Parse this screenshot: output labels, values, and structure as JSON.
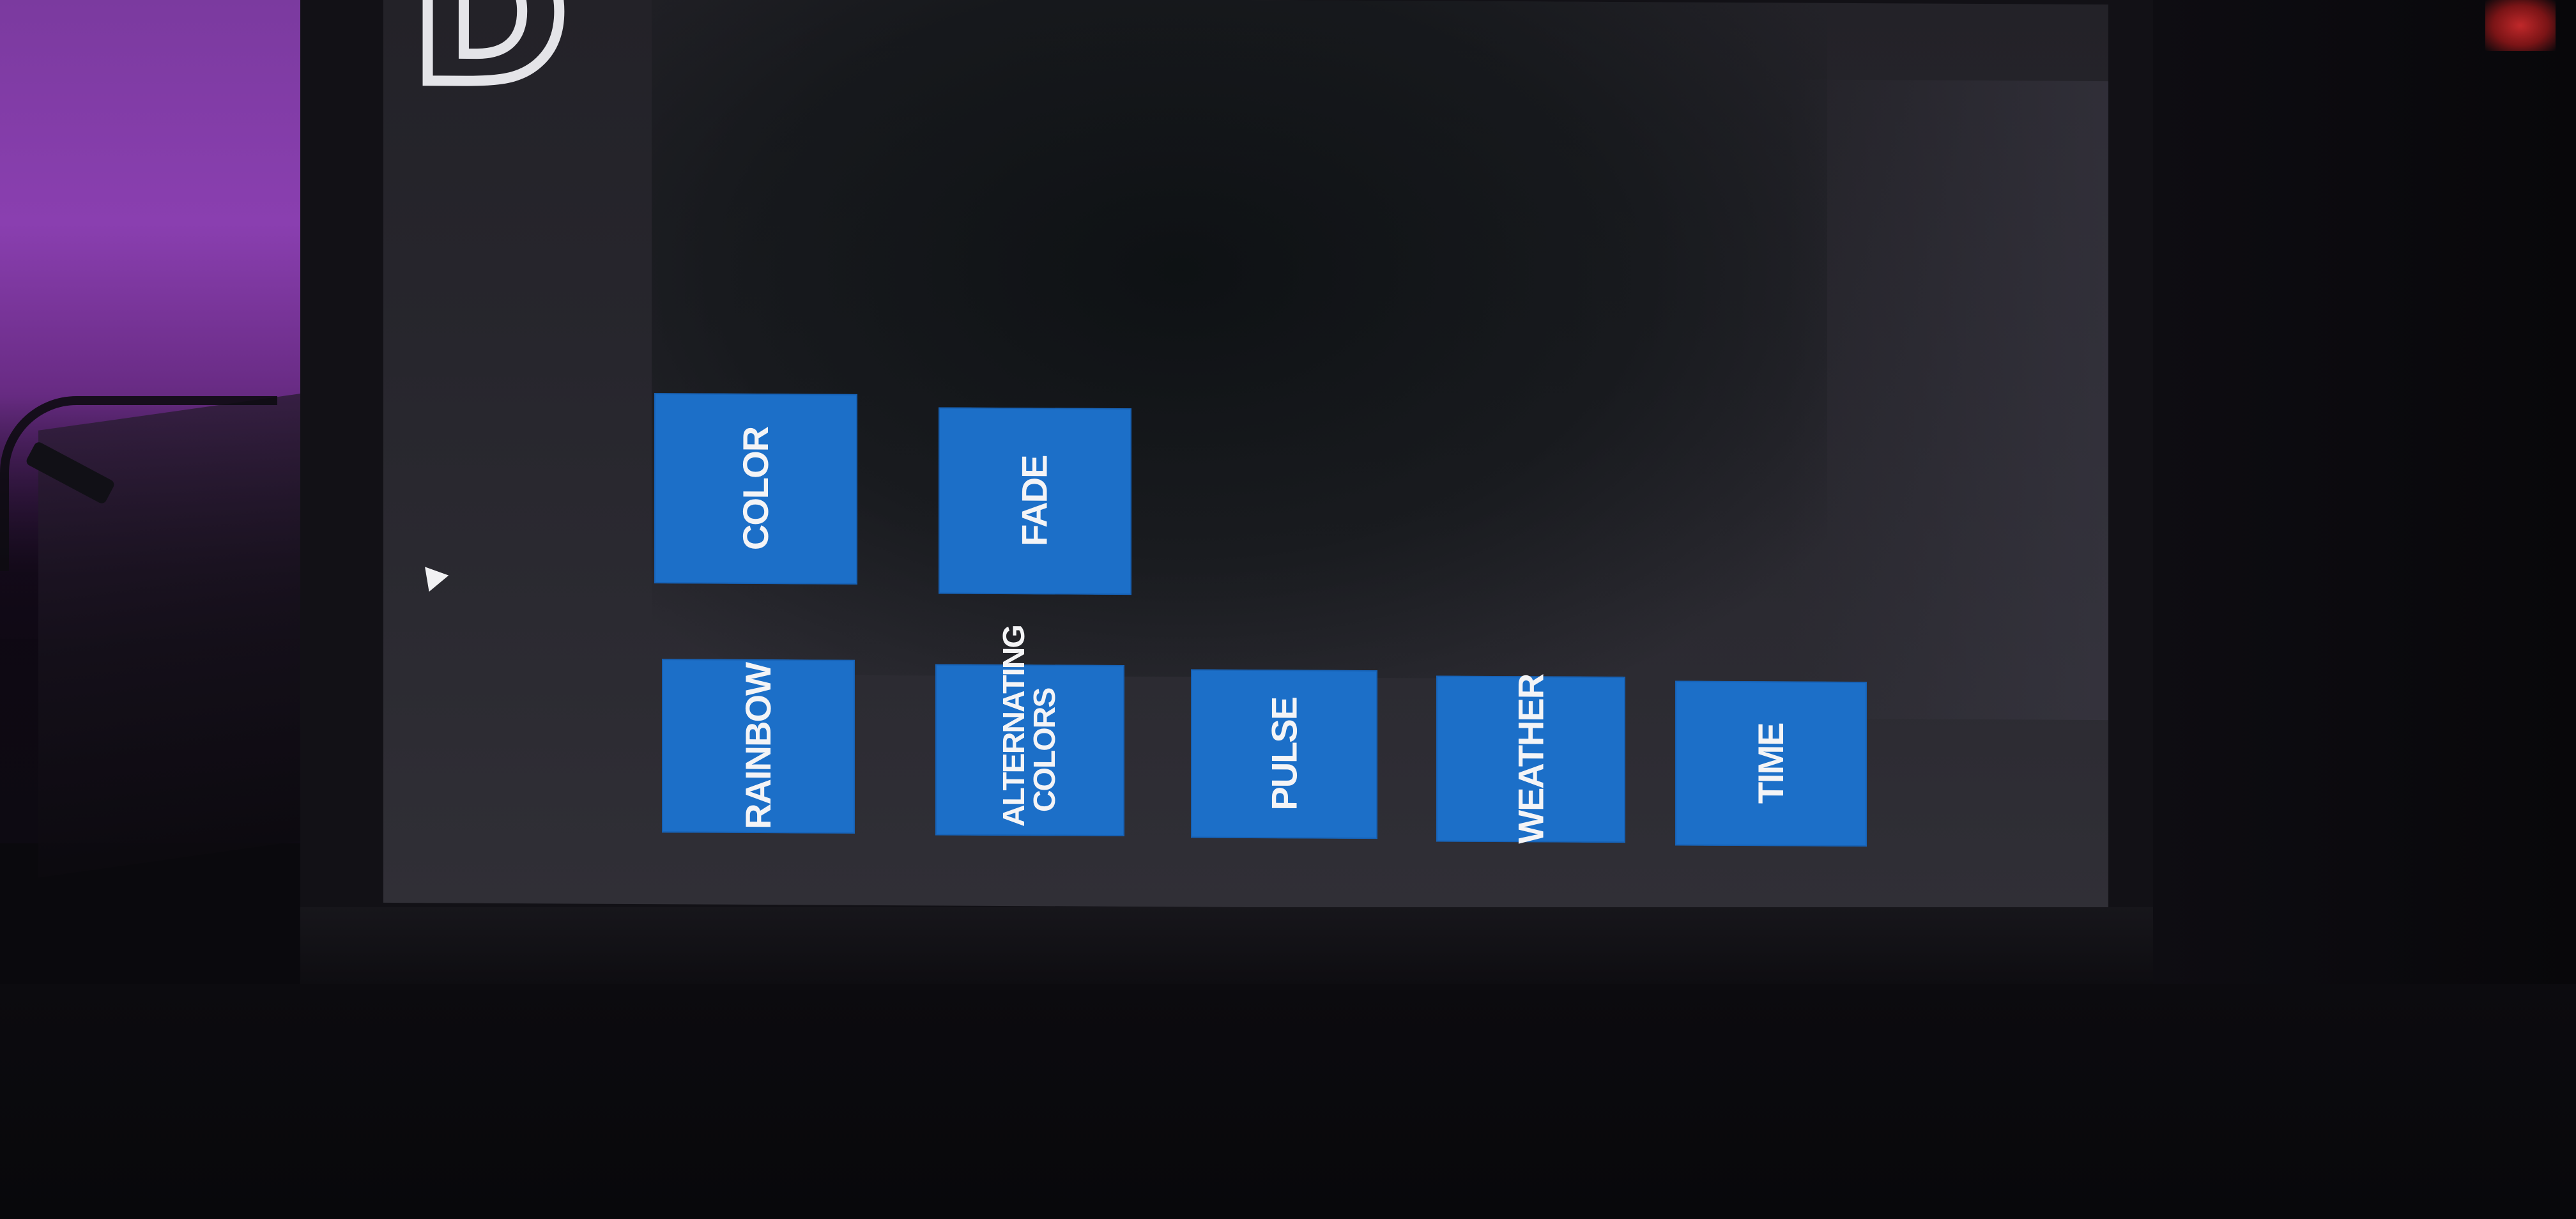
{
  "screen": {
    "title_fragment": "D"
  },
  "tiles": {
    "color": "COLOR",
    "fade": "FADE",
    "rainbow": "RAINBOW",
    "alternating_colors": "ALTERNATING COLORS",
    "pulse": "PULSE",
    "weather": "WEATHER",
    "time": "TIME"
  },
  "colors": {
    "tile_background": "#1c6fc8",
    "tile_text": "#f4f4f6",
    "screen_background": "#27262d",
    "wall_purple": "#8a3fb0"
  },
  "icons": {
    "cursor": "mouse-pointer-icon"
  }
}
